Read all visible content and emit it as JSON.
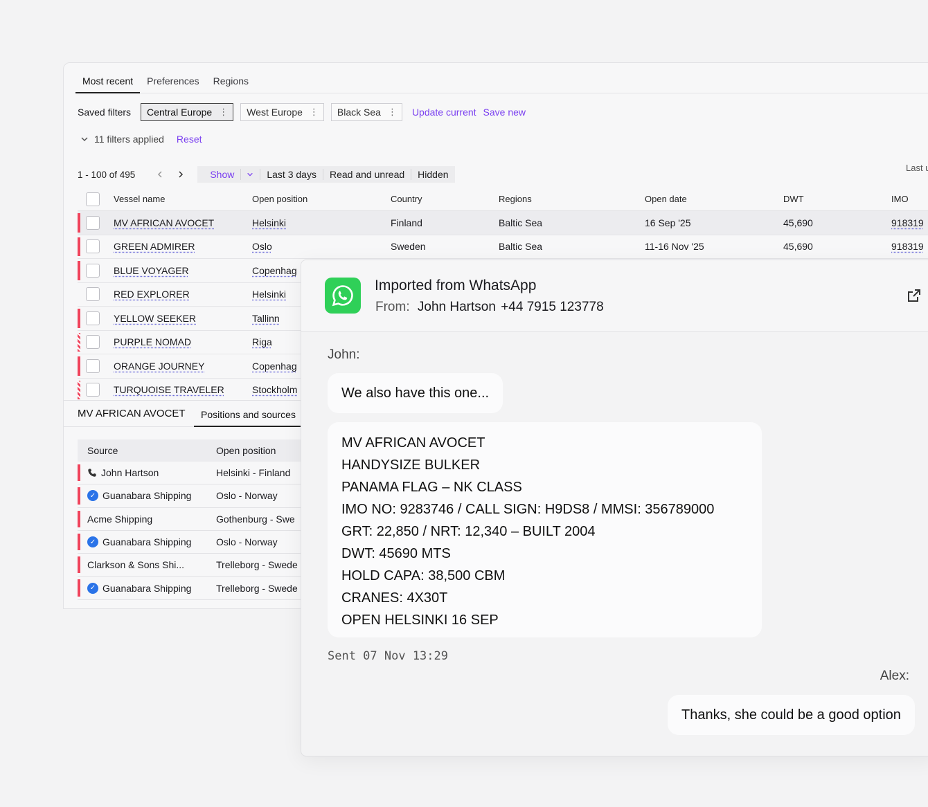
{
  "tabs": [
    "Most recent",
    "Preferences",
    "Regions"
  ],
  "filters": {
    "label": "Saved filters",
    "chips": [
      "Central Europe",
      "West Europe",
      "Black Sea"
    ],
    "update": "Update current",
    "save": "Save new",
    "applied": "11 filters applied",
    "reset": "Reset"
  },
  "pager": {
    "range": "1 - 100 of 495",
    "show": "Show",
    "options": [
      "Last 3 days",
      "Read and unread",
      "Hidden"
    ],
    "right": "Last u"
  },
  "table": {
    "headers": [
      "Vessel name",
      "Open position",
      "Country",
      "Regions",
      "Open date",
      "DWT",
      "IMO"
    ],
    "rows": [
      {
        "name": "MV AFRICAN AVOCET",
        "pos": "Helsinki",
        "country": "Finland",
        "region": "Baltic Sea",
        "date": "16 Sep '25",
        "dwt": "45,690",
        "imo": "918319"
      },
      {
        "name": "GREEN ADMIRER",
        "pos": "Oslo",
        "country": "Sweden",
        "region": "Baltic Sea",
        "date": "11-16 Nov '25",
        "dwt": "45,690",
        "imo": "918319"
      },
      {
        "name": "BLUE VOYAGER",
        "pos": "Copenhag",
        "country": "",
        "region": "",
        "date": "",
        "dwt": "",
        "imo": ""
      },
      {
        "name": "RED EXPLORER",
        "pos": "Helsinki",
        "country": "",
        "region": "",
        "date": "",
        "dwt": "",
        "imo": ""
      },
      {
        "name": "YELLOW SEEKER",
        "pos": "Tallinn",
        "country": "",
        "region": "",
        "date": "",
        "dwt": "",
        "imo": ""
      },
      {
        "name": "PURPLE NOMAD",
        "pos": "Riga",
        "country": "",
        "region": "",
        "date": "",
        "dwt": "",
        "imo": ""
      },
      {
        "name": "ORANGE JOURNEY",
        "pos": "Copenhag",
        "country": "",
        "region": "",
        "date": "",
        "dwt": "",
        "imo": ""
      },
      {
        "name": "TURQUOISE TRAVELER",
        "pos": "Stockholm",
        "country": "",
        "region": "",
        "date": "",
        "dwt": "",
        "imo": ""
      }
    ]
  },
  "detail": {
    "title": "MV AFRICAN AVOCET",
    "tab": "Positions and sources",
    "headers": [
      "Source",
      "Open position"
    ],
    "rows": [
      {
        "source": "John Hartson",
        "pos": "Helsinki - Finland",
        "icon": "phone"
      },
      {
        "source": "Guanabara Shipping",
        "pos": "Oslo - Norway",
        "icon": "verified"
      },
      {
        "source": "Acme Shipping",
        "pos": "Gothenburg - Swe",
        "icon": ""
      },
      {
        "source": "Guanabara Shipping",
        "pos": "Oslo - Norway",
        "icon": "verified"
      },
      {
        "source": "Clarkson & Sons Shi...",
        "pos": "Trelleborg - Swede",
        "icon": ""
      },
      {
        "source": "Guanabara Shipping",
        "pos": "Trelleborg - Swede",
        "icon": "verified"
      }
    ]
  },
  "chat": {
    "title": "Imported from WhatsApp",
    "from_label": "From:",
    "from_name": "John Hartson",
    "from_phone": "+44 7915 123778",
    "sender1": "John:",
    "msg1": "We also have this one...",
    "msg2": [
      "MV AFRICAN AVOCET",
      "HANDYSIZE BULKER",
      "PANAMA FLAG – NK CLASS",
      "IMO NO: 9283746 / CALL SIGN: H9DS8 / MMSI: 356789000",
      "GRT: 22,850 / NRT: 12,340 – BUILT 2004",
      "DWT: 45690 MTS",
      "HOLD CAPA: 38,500 CBM",
      "CRANES: 4X30T",
      "OPEN HELSINKI 16 SEP"
    ],
    "sent": "Sent 07 Nov 13:29",
    "sender2": "Alex:",
    "msg3": "Thanks, she could be a good option"
  },
  "colors": {
    "accent": "#7a3ff0",
    "flag": "#f0445c",
    "whatsapp": "#2fd058",
    "verified": "#2a73e8"
  }
}
